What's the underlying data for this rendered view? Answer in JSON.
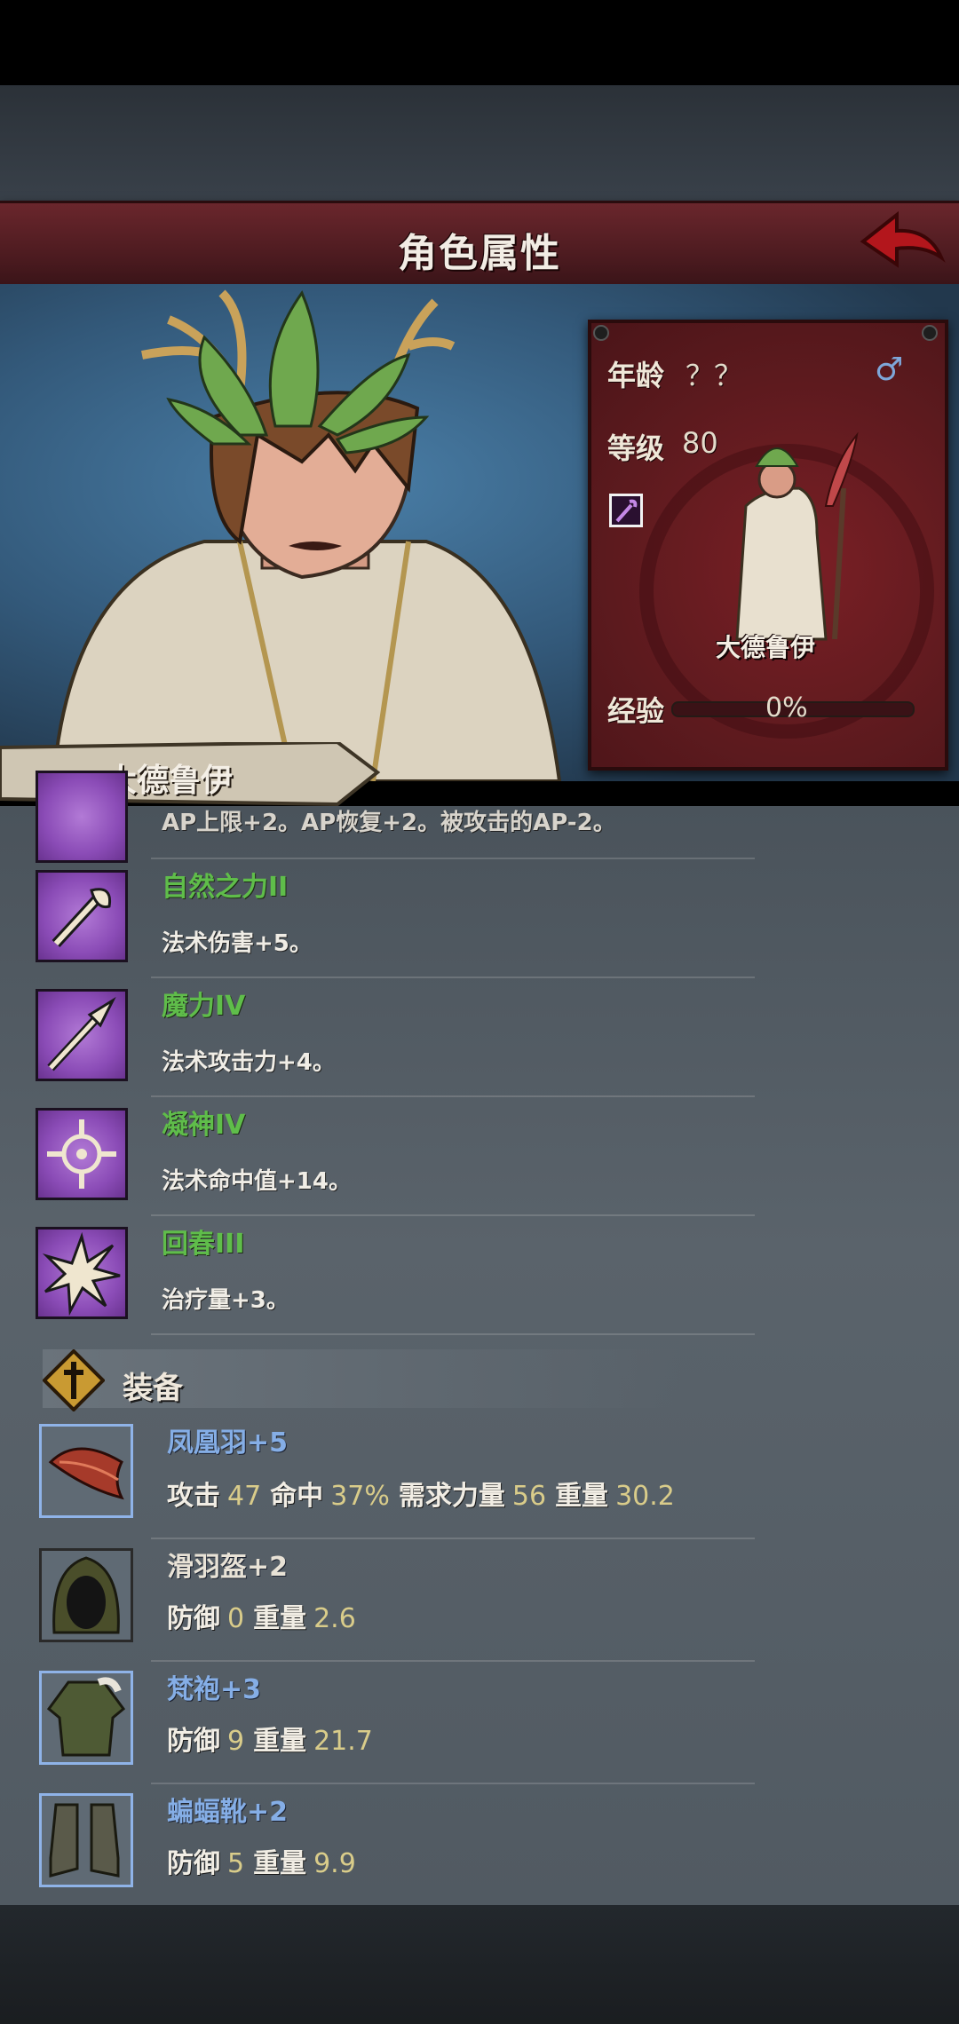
{
  "header": {
    "title": "角色属性"
  },
  "character": {
    "name": "大德鲁伊",
    "age_label": "年龄",
    "age_value": "？？",
    "level_label": "等级",
    "level_value": "80",
    "exp_label": "经验",
    "exp_value": "0%",
    "exp_progress": 0,
    "gender_icon": "male-icon",
    "class_icon": "staff-icon"
  },
  "skills": [
    {
      "name": "",
      "desc": "AP上限+2。AP恢复+2。被攻击的AP-2。",
      "icon": "partial-skill-icon"
    },
    {
      "name": "自然之力II",
      "desc": "法术伤害+5。",
      "icon": "nature-staff-icon"
    },
    {
      "name": "魔力IV",
      "desc": "法术攻击力+4。",
      "icon": "magic-spear-icon"
    },
    {
      "name": "凝神IV",
      "desc": "法术命中值+14。",
      "icon": "focus-crosshair-icon"
    },
    {
      "name": "回春III",
      "desc": "治疗量+3。",
      "icon": "rejuvenate-burst-icon"
    }
  ],
  "equipment_section": {
    "title": "装备",
    "icon": "cross-shield-icon"
  },
  "equipment": [
    {
      "name": "凤凰羽+5",
      "icon": "phoenix-feather-icon",
      "stats": [
        {
          "label": "攻击",
          "value": "47"
        },
        {
          "label": "命中",
          "value": "37%"
        },
        {
          "label": "需求力量",
          "value": "56"
        },
        {
          "label": "重量",
          "value": "30.2"
        }
      ]
    },
    {
      "name": "滑羽盔+2",
      "icon": "hood-icon",
      "stats": [
        {
          "label": "防御",
          "value": "0"
        },
        {
          "label": "重量",
          "value": "2.6"
        }
      ]
    },
    {
      "name": "梵袍+3",
      "icon": "robe-icon",
      "stats": [
        {
          "label": "防御",
          "value": "9"
        },
        {
          "label": "重量",
          "value": "21.7"
        }
      ]
    },
    {
      "name": "蝙蝠靴+2",
      "icon": "boots-icon",
      "stats": [
        {
          "label": "防御",
          "value": "5"
        },
        {
          "label": "重量",
          "value": "9.9"
        }
      ]
    }
  ]
}
